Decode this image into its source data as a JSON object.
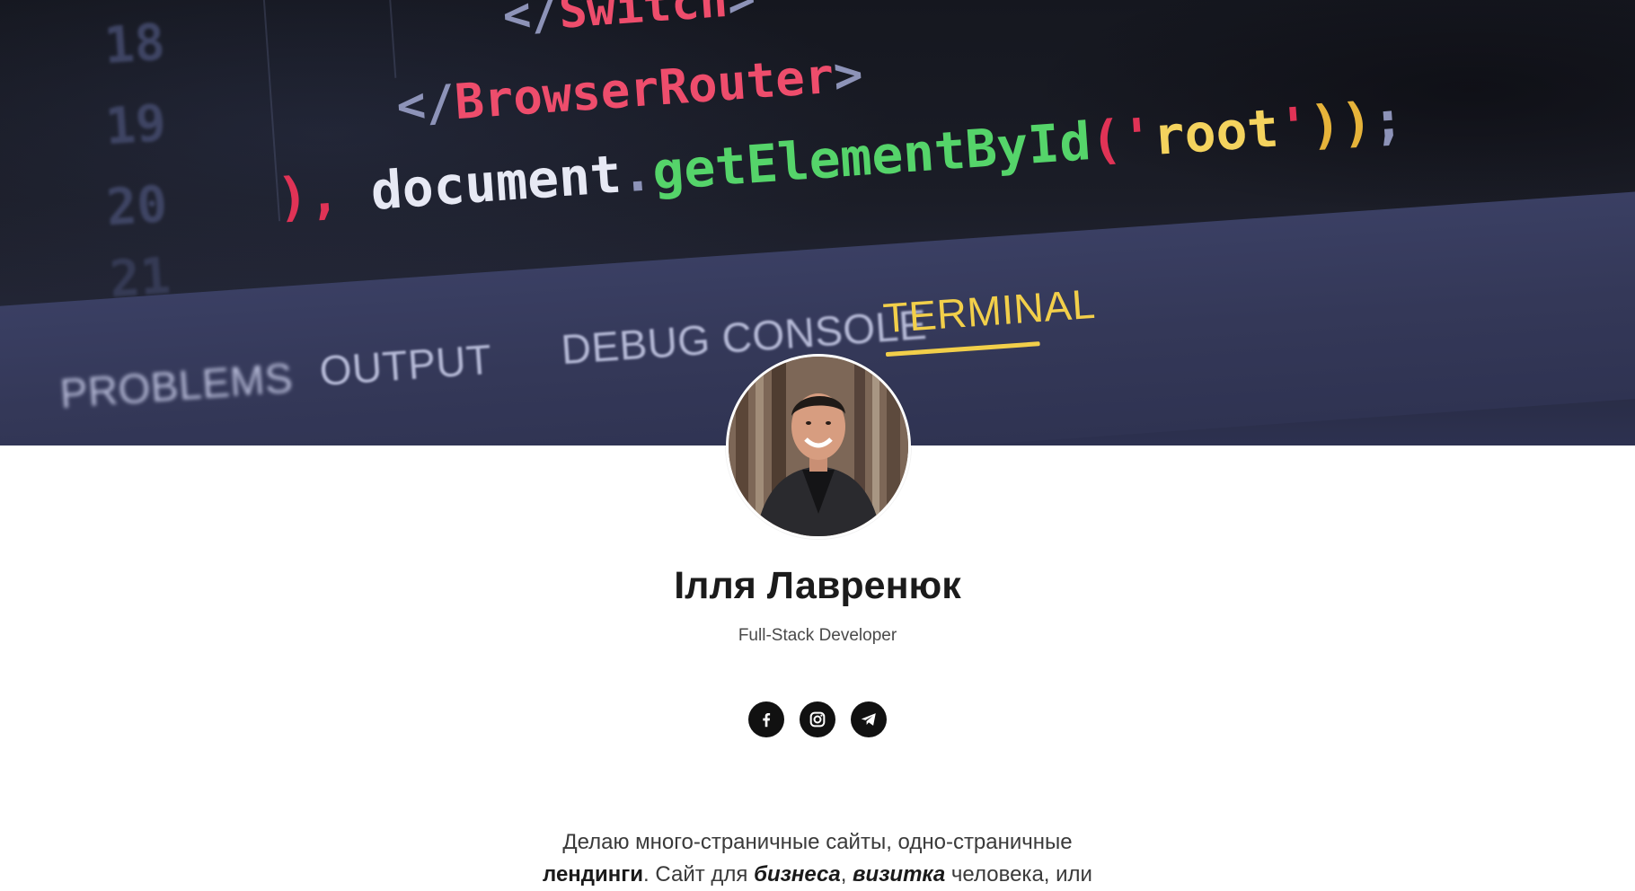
{
  "hero": {
    "code_lines": [
      {
        "num": "18",
        "parts": [
          {
            "t": "</",
            "c": "tok-punct"
          },
          {
            "t": "Switch",
            "c": "tok-tag"
          },
          {
            "t": ">",
            "c": "tok-punct"
          }
        ]
      },
      {
        "num": "19",
        "parts": [
          {
            "t": "</",
            "c": "tok-punct"
          },
          {
            "t": "BrowserRouter",
            "c": "tok-tag"
          },
          {
            "t": ">",
            "c": "tok-punct"
          }
        ]
      },
      {
        "num": "20",
        "parts": [
          {
            "t": "), ",
            "c": "tok-red"
          },
          {
            "t": "document",
            "c": "tok-ident"
          },
          {
            "t": ".",
            "c": "tok-punct"
          },
          {
            "t": "getElementById",
            "c": "tok-func"
          },
          {
            "t": "('",
            "c": "tok-red"
          },
          {
            "t": "root",
            "c": "tok-str"
          },
          {
            "t": "'",
            "c": "tok-red"
          },
          {
            "t": "))",
            "c": "tok-paren"
          },
          {
            "t": ";",
            "c": "tok-punct"
          }
        ]
      },
      {
        "num": "21",
        "parts": []
      }
    ],
    "tabs": [
      "PROBLEMS",
      "OUTPUT",
      "DEBUG CONSOLE",
      "TERMINAL"
    ],
    "active_tab": "TERMINAL"
  },
  "profile": {
    "name": "Ілля Лавренюк",
    "role": "Full-Stack Developer",
    "avatar_icon": "avatar-photo"
  },
  "socials": [
    {
      "name": "facebook",
      "icon": "facebook-icon"
    },
    {
      "name": "instagram",
      "icon": "instagram-icon"
    },
    {
      "name": "telegram",
      "icon": "telegram-icon"
    }
  ],
  "bio": {
    "line1": "Делаю много-страничные сайты, одно-страничные",
    "line2_bold": "лендинги",
    "line2_a": ". Сайт для ",
    "line2_italic1": "бизнеса",
    "line2_b": ", ",
    "line2_italic2": "визитка",
    "line2_c": " человека, или"
  }
}
